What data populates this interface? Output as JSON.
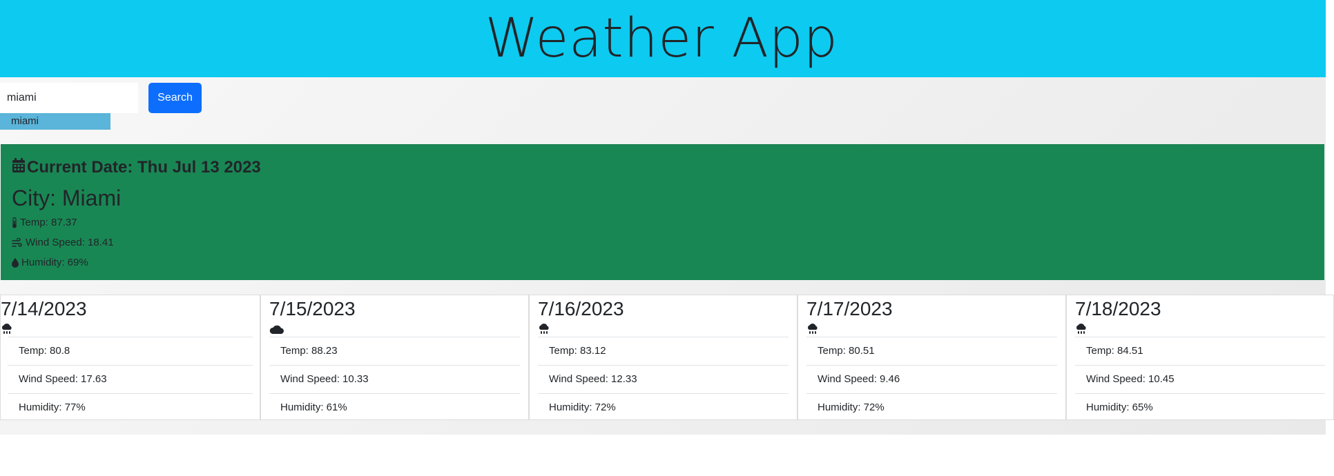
{
  "header": {
    "title": "Weather App"
  },
  "search": {
    "value": "miami",
    "button_label": "Search",
    "history": [
      "miami"
    ]
  },
  "current": {
    "date_label": "Current Date: Thu Jul 13 2023",
    "city_label": "City: Miami",
    "temp": "Temp: 87.37",
    "wind": "Wind Speed: 18.41",
    "humidity": "Humidity: 69%",
    "icons": [
      "calendar-icon",
      "thermometer-icon",
      "wind-icon",
      "droplet-icon"
    ]
  },
  "forecast": [
    {
      "date": "7/14/2023",
      "icon": "rain-cloud-icon",
      "temp": "Temp: 80.8",
      "wind": "Wind Speed: 17.63",
      "humidity": "Humidity: 77%"
    },
    {
      "date": "7/15/2023",
      "icon": "cloud-icon",
      "temp": "Temp: 88.23",
      "wind": "Wind Speed: 10.33",
      "humidity": "Humidity: 61%"
    },
    {
      "date": "7/16/2023",
      "icon": "rain-cloud-icon",
      "temp": "Temp: 83.12",
      "wind": "Wind Speed: 12.33",
      "humidity": "Humidity: 72%"
    },
    {
      "date": "7/17/2023",
      "icon": "rain-cloud-icon",
      "temp": "Temp: 80.51",
      "wind": "Wind Speed: 9.46",
      "humidity": "Humidity: 72%"
    },
    {
      "date": "7/18/2023",
      "icon": "rain-cloud-icon",
      "temp": "Temp: 84.51",
      "wind": "Wind Speed: 10.45",
      "humidity": "Humidity: 65%"
    }
  ],
  "colors": {
    "header_bg": "#0dcaf0",
    "search_button": "#0d6efd",
    "history_item": "#5bb4d9",
    "current_bg": "#198754"
  }
}
